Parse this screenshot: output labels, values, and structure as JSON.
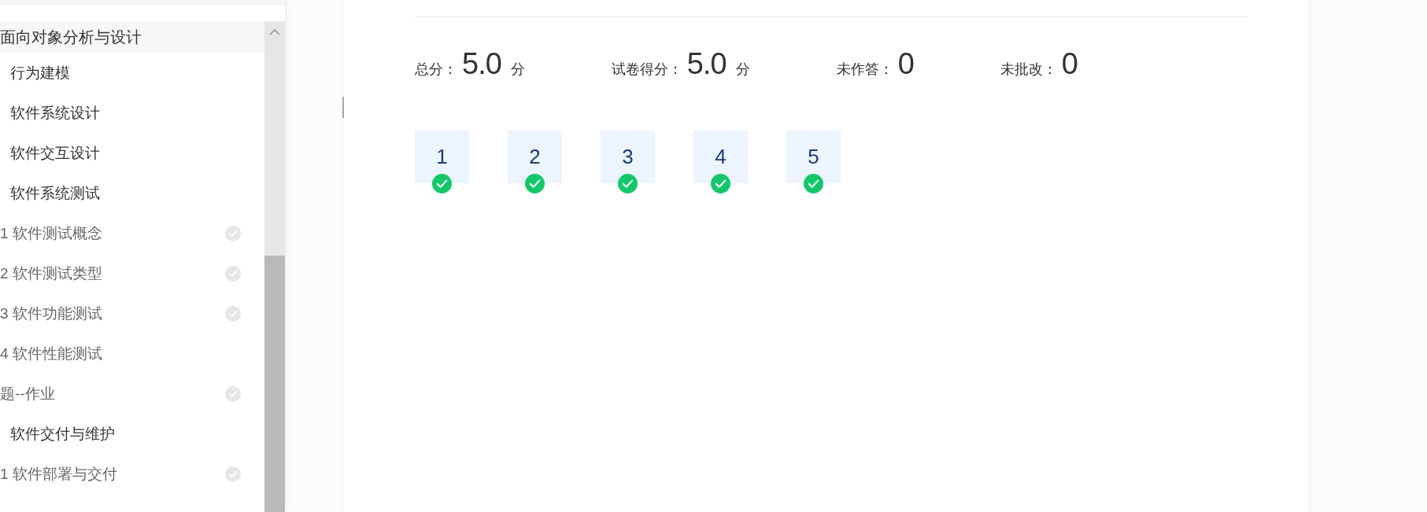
{
  "sidebar": {
    "outline": [
      {
        "label": "面向对象分析与设计",
        "children": [
          {
            "label": "行为建模"
          },
          {
            "label": "软件系统设计"
          },
          {
            "label": "软件交互设计"
          },
          {
            "label": "软件系统测试",
            "children": [
              {
                "label": "1 软件测试概念",
                "check_mark": true
              },
              {
                "label": "2 软件测试类型",
                "check_mark": true
              },
              {
                "label": "3 软件功能测试",
                "check_mark": true
              },
              {
                "label": "4 软件性能测试",
                "check_mark": false
              },
              {
                "label": "题--作业",
                "check_mark": true
              }
            ]
          },
          {
            "label": "软件交付与维护",
            "children": [
              {
                "label": "1 软件部署与交付",
                "check_mark": true
              }
            ]
          }
        ]
      }
    ]
  },
  "results": {
    "summary": [
      {
        "label": "总分：",
        "value": "5.0",
        "unit": "分"
      },
      {
        "label": "试卷得分：",
        "value": "5.0",
        "unit": "分"
      },
      {
        "label": "未作答：",
        "value": "0"
      },
      {
        "label": "未批改：",
        "value": "0"
      }
    ],
    "questions": [
      {
        "number": "1",
        "correct": true
      },
      {
        "number": "2",
        "correct": true
      },
      {
        "number": "3",
        "correct": true
      },
      {
        "number": "4",
        "correct": true
      },
      {
        "number": "5",
        "correct": true
      }
    ]
  }
}
